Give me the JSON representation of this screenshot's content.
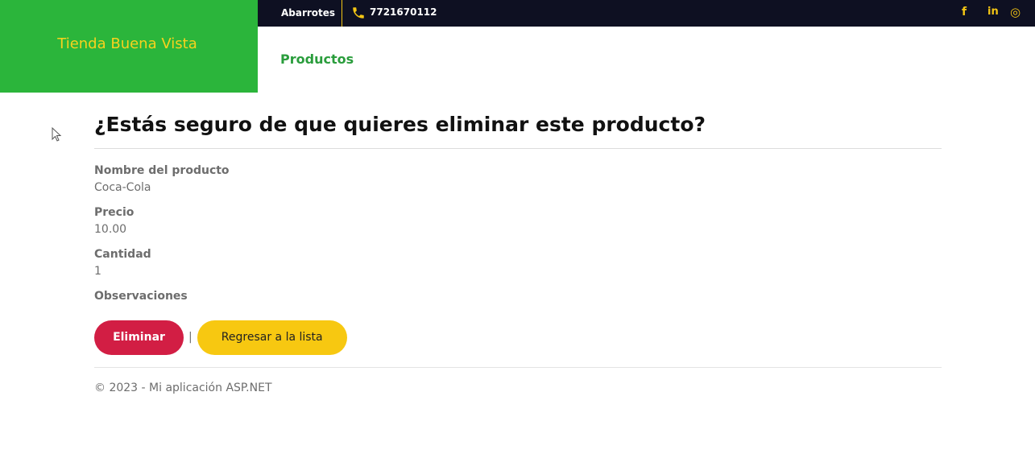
{
  "header": {
    "brand_name": "Tienda Buena Vista",
    "category": "Abarrotes",
    "phone": "7721670112",
    "social": {
      "facebook": "f",
      "linkedin": "in",
      "instagram": "◎"
    },
    "nav": {
      "productos": "Productos"
    }
  },
  "colors": {
    "brand_green": "#2bb53b",
    "topbar_navy": "#0e1022",
    "accent_yellow": "#f3c514",
    "delete_red": "#d21e44",
    "back_yellow": "#f7c811"
  },
  "main": {
    "title": "¿Estás seguro de que quieres eliminar este producto?",
    "fields": [
      {
        "label": "Nombre del producto",
        "value": "Coca-Cola"
      },
      {
        "label": "Precio",
        "value": "10.00"
      },
      {
        "label": "Cantidad",
        "value": "1"
      },
      {
        "label": "Observaciones",
        "value": ""
      }
    ],
    "actions": {
      "delete_label": "Eliminar",
      "separator": "|",
      "back_label": "Regresar a la lista"
    }
  },
  "footer": {
    "text": "© 2023 - Mi aplicación ASP.NET"
  }
}
